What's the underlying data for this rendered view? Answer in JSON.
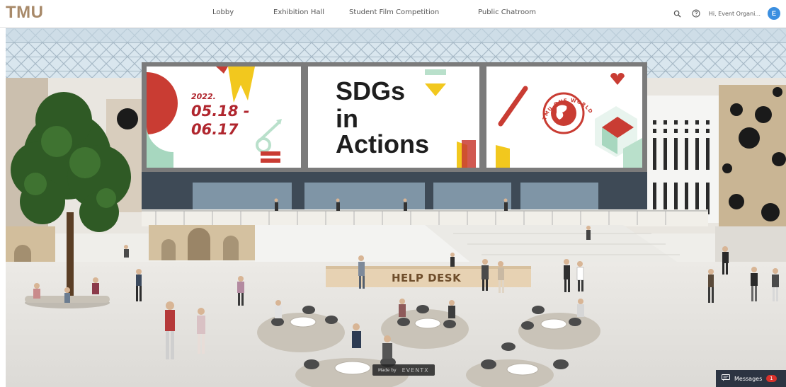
{
  "app": {
    "logo": "TMU"
  },
  "nav": {
    "items": [
      "Lobby",
      "Exhibition Hall",
      "Student Film Competition",
      "Public Chatroom"
    ]
  },
  "header": {
    "user_name": "Hi, Event Organi...",
    "avatar_initial": "E"
  },
  "icons": [
    "search-icon",
    "help-icon",
    "messages-icon"
  ],
  "banner": {
    "date_year": "2022.",
    "date_start": "05.18 -",
    "date_end": "06.17",
    "headline_1": "SDGs",
    "headline_2": "in",
    "headline_3": "Actions",
    "logo_text": "TMU ONE WORLD"
  },
  "scene": {
    "help_desk": "HELP DESK"
  },
  "footer": {
    "made_by": "Made by",
    "brand": "EVENTX"
  },
  "messages": {
    "label": "Messages",
    "count": "1"
  },
  "colors": {
    "brand": "#a88a6a",
    "accent_red": "#b0262e",
    "avatar_blue": "#3b8fe0",
    "messages_bg": "#2c3442"
  }
}
